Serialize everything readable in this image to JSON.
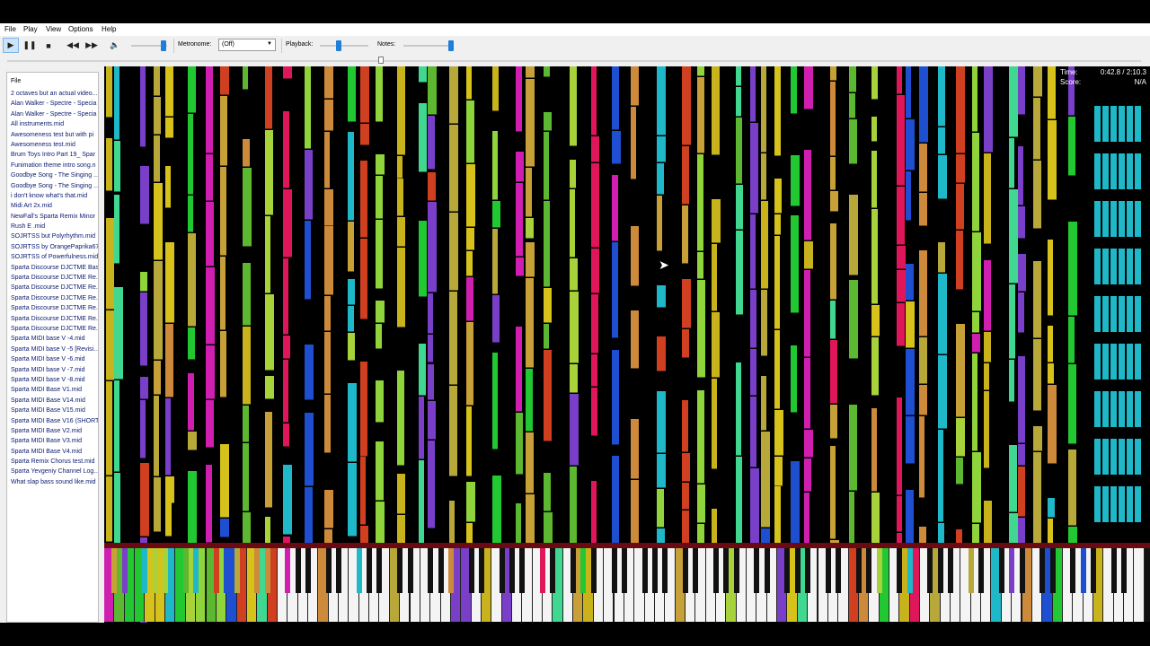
{
  "menu": {
    "file": "File",
    "play": "Play",
    "view": "View",
    "options": "Options",
    "help": "Help"
  },
  "toolbar": {
    "metronome_label": "Metronome:",
    "metronome_value": "(Off)",
    "playback_label": "Playback:",
    "notes_label": "Notes:",
    "icons": [
      "play-icon",
      "pause-icon",
      "stop-icon",
      "rewind-icon",
      "fast-forward-icon",
      "volume-icon"
    ],
    "volume_level": 0.9,
    "playback_level": 0.38,
    "notes_level": 0.98
  },
  "seek": {
    "position": 0.33
  },
  "sidebar": {
    "header": "File",
    "files": [
      "2 octaves but an actual video...",
      "Alan Walker - Spectre - Specia",
      "Alan Walker - Spectre - Specia",
      "All instruments.mid",
      "Awesomeness test but with pi",
      "Awesomeness test.mid",
      "Brum Toys Intro Part 19_ Spar",
      "Funimation theme intro song.n",
      "Goodbye Song - The Singing ...",
      "Goodbye Song - The Singing ...",
      "i don't know what's that.mid",
      "Midi Art 2x.mid",
      "NewFall's Sparta Remix Minor",
      "Rush E .mid",
      "SOJRTSS but Polyrhythm.mid",
      "SOJRTSS by OrangePaprika67",
      "SOJRTSS of Powerfulness.mid",
      "Sparta Discourse DJCTME Bas",
      "Sparta Discourse DJCTME Re...",
      "Sparta Discourse DJCTME Re...",
      "Sparta Discourse DJCTME Re...",
      "Sparta Discourse DJCTME Re...",
      "Sparta Discourse DJCTME Re...",
      "Sparta Discourse DJCTME Re...",
      "Sparta MIDI base V -4.mid",
      "Sparta MIDI base V -5 [Revisi...",
      "Sparta MIDI base V -6.mid",
      "Sparta MIDI base V -7.mid",
      "Sparta MIDI base V -8.mid",
      "Sparta MIDI Base V1.mid",
      "Sparta MIDI Base V14.mid",
      "Sparta MIDI Base V15.mid",
      "Sparta MIDI Base V16 (SHORT",
      "Sparta MIDI Base V2.mid",
      "Sparta MIDI Base V3.mid",
      "Sparta MIDI Base V4.mid",
      "Sparta Remix Chorus test.mid",
      "Sparta Yevgeniy Channel Log...",
      "What slap bass sound like.mid"
    ]
  },
  "hud": {
    "time_label": "Time:",
    "time_value": "0:42.8 / 2:10.3",
    "score_label": "Score:",
    "score_value": "N/A"
  },
  "colors": {
    "palette": [
      "#c9b31c",
      "#40d890",
      "#7a3fc8",
      "#b8a83a",
      "#d6c21a",
      "#22c832",
      "#d01fb0",
      "#c8a038",
      "#5cb830",
      "#a8d23a",
      "#e0165a",
      "#1e4fd0",
      "#cc8a3a",
      "#1fb8c8",
      "#d04020",
      "#8fd43a"
    ]
  }
}
